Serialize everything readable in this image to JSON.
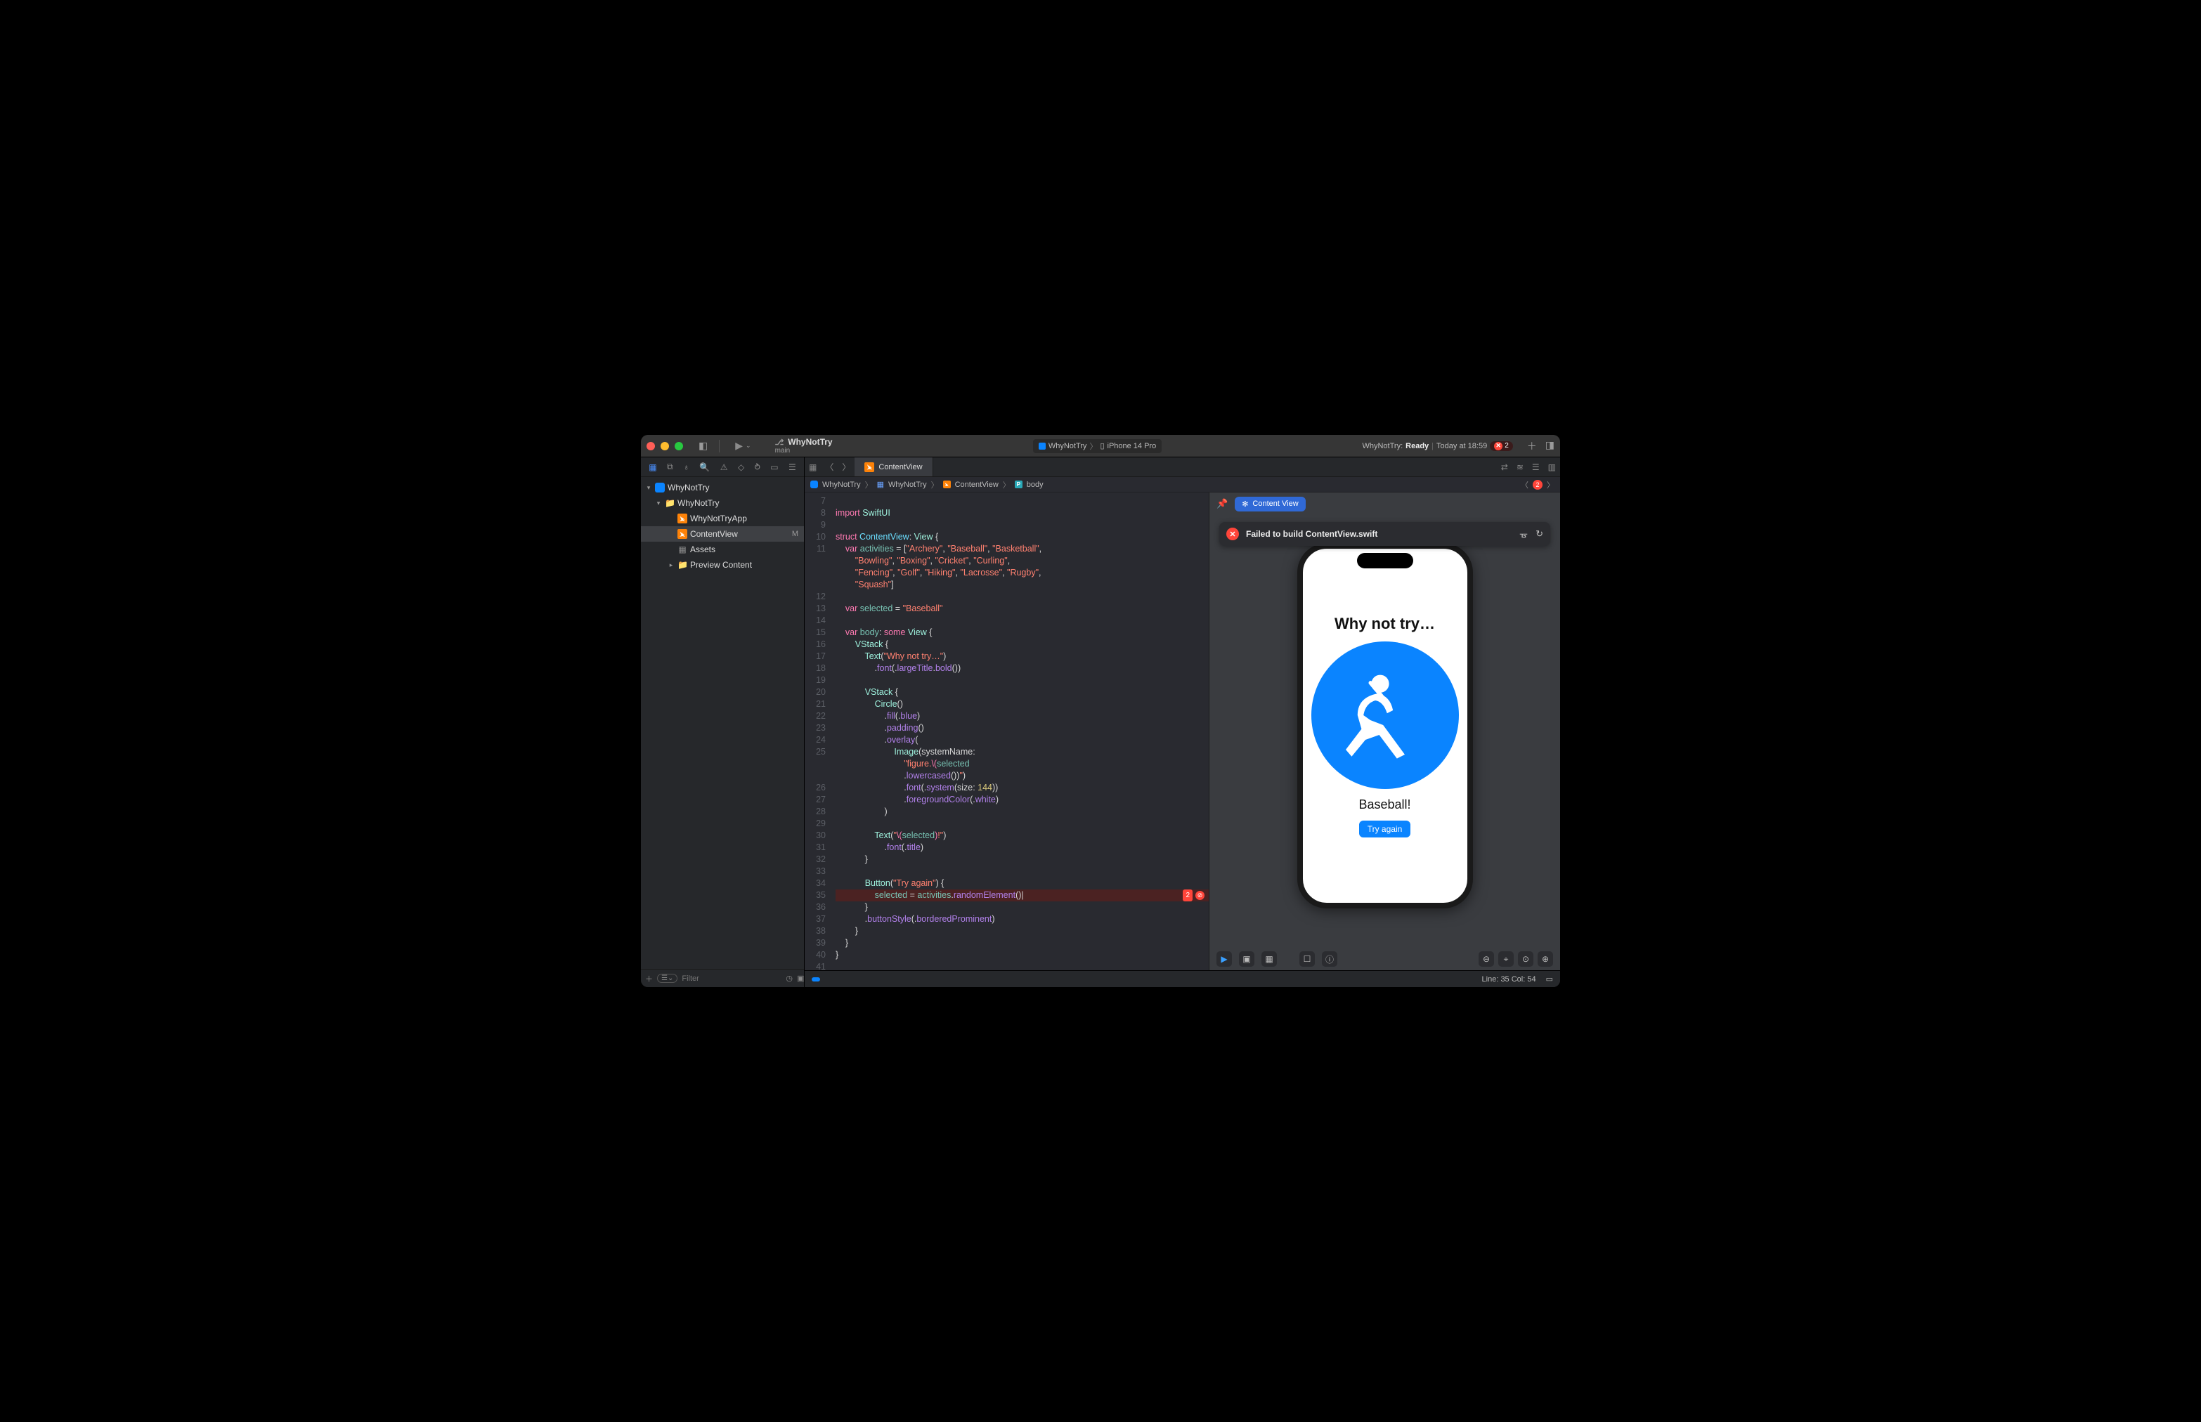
{
  "titlebar": {
    "project": "WhyNotTry",
    "branch": "main",
    "scheme": "WhyNotTry",
    "destination": "iPhone 14 Pro",
    "status_prefix": "WhyNotTry:",
    "status_ready": "Ready",
    "status_time": "Today at 18:59",
    "error_count": "2"
  },
  "sidebar": {
    "filter_placeholder": "Filter",
    "nodes": [
      {
        "label": "WhyNotTry"
      },
      {
        "label": "WhyNotTry"
      },
      {
        "label": "WhyNotTryApp"
      },
      {
        "label": "ContentView",
        "status": "M"
      },
      {
        "label": "Assets"
      },
      {
        "label": "Preview Content"
      }
    ]
  },
  "editor_tab": {
    "name": "ContentView"
  },
  "breadcrumb": {
    "items": [
      "WhyNotTry",
      "WhyNotTry",
      "ContentView",
      "body"
    ],
    "error_count": "2"
  },
  "gutter": {
    "start_blank": "",
    "lines": [
      "7",
      "8",
      "9",
      "10",
      "11",
      "",
      "",
      "",
      "12",
      "13",
      "14",
      "15",
      "16",
      "17",
      "18",
      "19",
      "20",
      "21",
      "22",
      "23",
      "24",
      "25",
      "",
      "",
      "26",
      "27",
      "28",
      "29",
      "30",
      "31",
      "32",
      "33",
      "34",
      "35",
      "36",
      "37",
      "38",
      "39",
      "40",
      "41",
      ""
    ]
  },
  "code": {
    "activities": [
      "Archery",
      "Baseball",
      "Basketball",
      "Bowling",
      "Boxing",
      "Cricket",
      "Curling",
      "Fencing",
      "Golf",
      "Hiking",
      "Lacrosse",
      "Rugby",
      "Squash"
    ],
    "selected_default": "Baseball",
    "title_text": "Why not try…",
    "button_text": "Try again",
    "font_size": "144",
    "inline_error_count": "2"
  },
  "canvas": {
    "chip": "Content View",
    "banner": "Failed to build ContentView.swift",
    "phone_title": "Why not try…",
    "phone_selected": "Baseball!",
    "phone_button": "Try again"
  },
  "statusbar": {
    "line": "35",
    "col": "54",
    "text": "Line: 35  Col: 54"
  }
}
